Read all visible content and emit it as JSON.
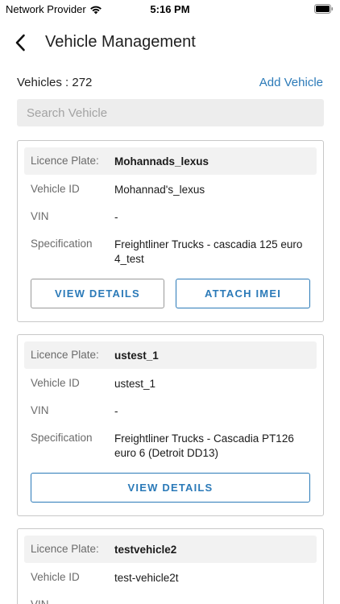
{
  "status_bar": {
    "carrier": "Network Provider",
    "time": "5:16 PM"
  },
  "header": {
    "title": "Vehicle Management"
  },
  "summary": {
    "count_label": "Vehicles : 272",
    "add_vehicle_label": "Add Vehicle"
  },
  "search": {
    "placeholder": "Search Vehicle",
    "value": ""
  },
  "labels": {
    "licence_plate": "Licence Plate:",
    "vehicle_id": "Vehicle ID",
    "vin": "VIN",
    "specification": "Specification",
    "view_details": "VIEW DETAILS",
    "attach_imei": "ATTACH IMEI"
  },
  "vehicles": [
    {
      "licence_plate": "Mohannads_lexus",
      "vehicle_id": "Mohannad's_lexus",
      "vin": "-",
      "specification": "Freightliner Trucks - cascadia 125 euro 4_test"
    },
    {
      "licence_plate": "ustest_1",
      "vehicle_id": "ustest_1",
      "vin": "-",
      "specification": "Freightliner Trucks - Cascadia PT126 euro 6 (Detroit DD13)"
    },
    {
      "licence_plate": "testvehicle2",
      "vehicle_id": "test-vehicle2t",
      "vin": "-"
    }
  ],
  "colors": {
    "accent": "#2b7ab8",
    "card_border": "#c8c8c8",
    "row_highlight": "#f2f2f2",
    "search_bg": "#ededed"
  },
  "icons": {
    "back": "chevron-left-icon",
    "wifi": "wifi-icon",
    "battery": "battery-icon"
  }
}
